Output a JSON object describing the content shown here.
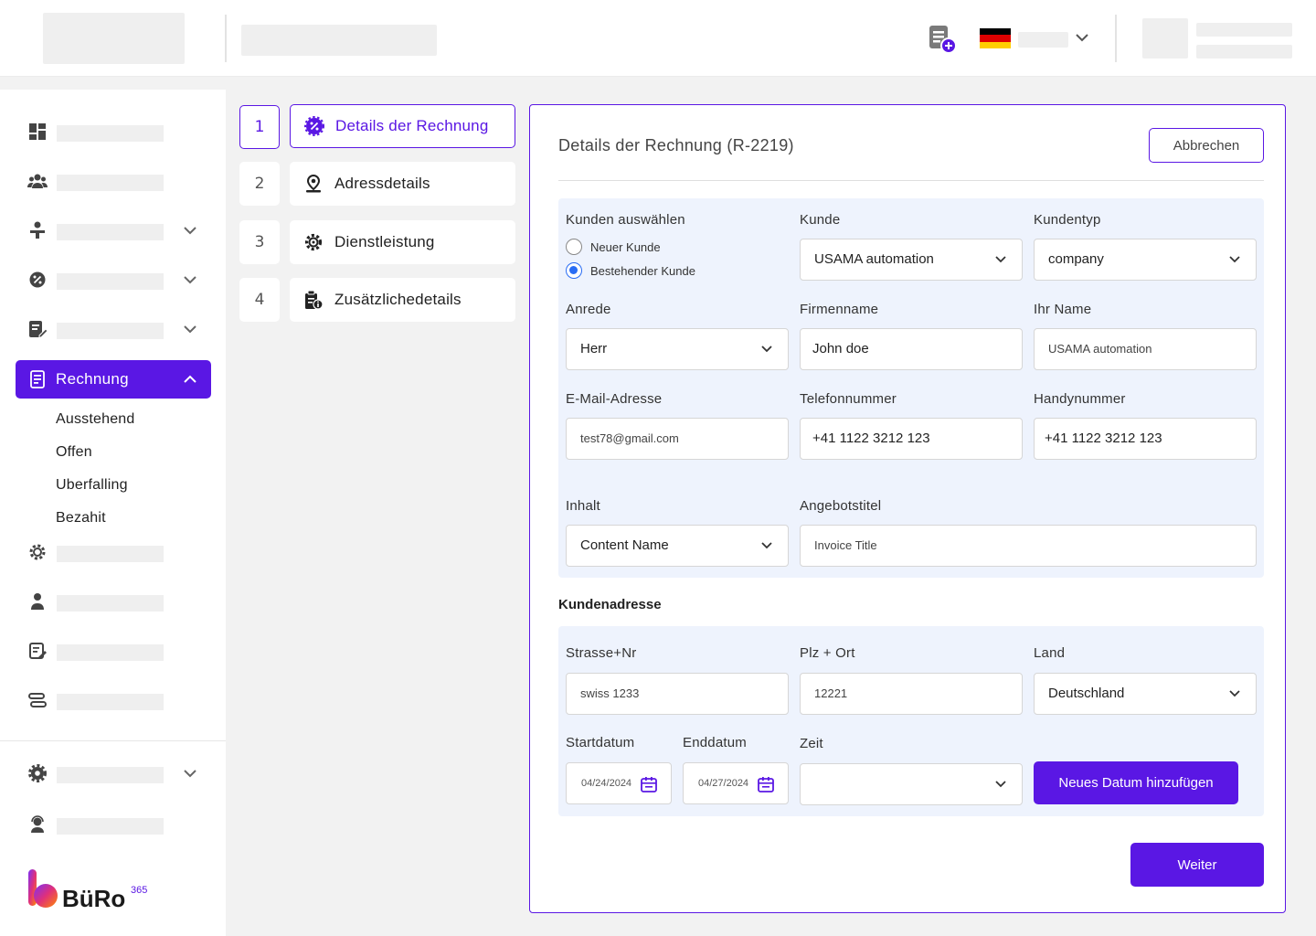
{
  "sidebar": {
    "active_item": "Rechnung",
    "sub_items": [
      "Ausstehend",
      "Offen",
      "Uberfalling",
      "Bezahit"
    ],
    "logo_text": "BüRo",
    "logo_sup": "365"
  },
  "steps": [
    {
      "number": "1",
      "label": "Details der Rechnung",
      "icon": "badge-percent-icon",
      "active": true
    },
    {
      "number": "2",
      "label": "Adressdetails",
      "icon": "location-person-icon",
      "active": false
    },
    {
      "number": "3",
      "label": "Dienstleistung",
      "icon": "gear-service-icon",
      "active": false
    },
    {
      "number": "4",
      "label": "Zusätzlichedetails",
      "icon": "document-info-icon",
      "active": false
    }
  ],
  "card": {
    "title": "Details der Rechnung (R-2219)",
    "cancel_label": "Abbrechen",
    "next_label": "Weiter"
  },
  "customer": {
    "select_label": "Kunden auswählen",
    "radio_new": "Neuer Kunde",
    "radio_existing": "Bestehender Kunde",
    "selected_radio": "Bestehender Kunde",
    "kunde_label": "Kunde",
    "kunde_value": "USAMA automation",
    "kundentyp_label": "Kundentyp",
    "kundentyp_value": "company",
    "anrede_label": "Anrede",
    "anrede_value": "Herr",
    "firmenname_label": "Firmenname",
    "firmenname_value": "John doe",
    "ihr_name_label": "Ihr Name",
    "ihr_name_value": "USAMA automation",
    "email_label": "E-Mail-Adresse",
    "email_value": "test78@gmail.com",
    "telefon_label": "Telefonnummer",
    "telefon_value": "+41 1122 3212 123",
    "handy_label": "Handynummer",
    "handy_value": "+41 1122 3212 123",
    "inhalt_label": "Inhalt",
    "inhalt_value": "Content Name",
    "angebot_label": "Angebotstitel",
    "angebot_value": "Invoice Title"
  },
  "address": {
    "heading": "Kundenadresse",
    "strasse_label": "Strasse+Nr",
    "strasse_value": "swiss 1233",
    "plz_label": "Plz + Ort",
    "plz_value": "12221",
    "land_label": "Land",
    "land_value": "Deutschland",
    "start_label": "Startdatum",
    "start_value": "04/24/2024",
    "end_label": "Enddatum",
    "end_value": "04/27/2024",
    "zeit_label": "Zeit",
    "zeit_value": "",
    "add_date_label": "Neues Datum hinzufügen"
  },
  "colors": {
    "accent": "#5a17e4",
    "panel": "#eef3fd",
    "radio": "#2a6df4"
  }
}
